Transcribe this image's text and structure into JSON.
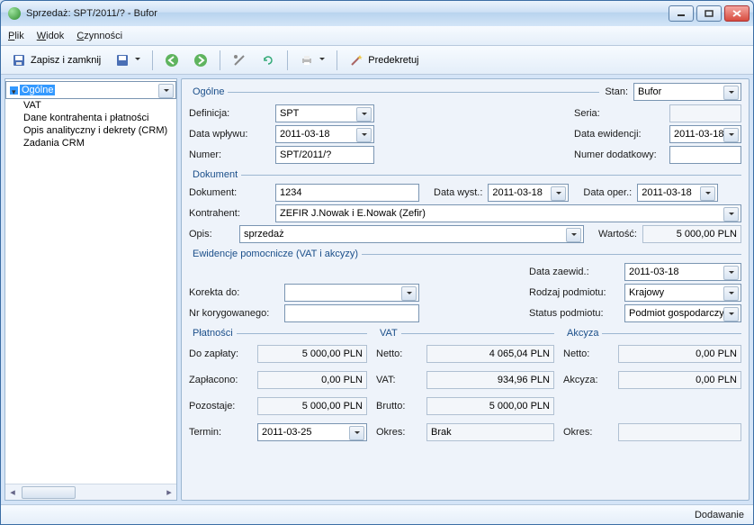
{
  "titlebar": {
    "title": "Sprzedaż: SPT/2011/? - Bufor"
  },
  "menu": {
    "plik": "Plik",
    "widok": "Widok",
    "czynnosci": "Czynności"
  },
  "toolbar": {
    "save_close": "Zapisz i zamknij",
    "predekretuj": "Predekretuj"
  },
  "sidebar": {
    "items": [
      "Ogólne",
      "VAT",
      "Dane kontrahenta i płatności",
      "Opis analityczny i dekrety (CRM)",
      "Zadania CRM"
    ]
  },
  "ogolne": {
    "legend": "Ogólne",
    "stan_label": "Stan:",
    "stan_value": "Bufor",
    "definicja_label": "Definicja:",
    "definicja_value": "SPT",
    "seria_label": "Seria:",
    "seria_value": "",
    "data_wplywu_label": "Data wpływu:",
    "data_wplywu_value": "2011-03-18",
    "data_ewid_label": "Data ewidencji:",
    "data_ewid_value": "2011-03-18",
    "numer_label": "Numer:",
    "numer_value": "SPT/2011/?",
    "numer_dod_label": "Numer dodatkowy:",
    "numer_dod_value": ""
  },
  "dokument": {
    "legend": "Dokument",
    "dokument_label": "Dokument:",
    "dokument_value": "1234",
    "data_wyst_label": "Data wyst.:",
    "data_wyst_value": "2011-03-18",
    "data_oper_label": "Data oper.:",
    "data_oper_value": "2011-03-18",
    "kontrahent_label": "Kontrahent:",
    "kontrahent_value": "ZEFIR J.Nowak i E.Nowak (Zefir)",
    "opis_label": "Opis:",
    "opis_value": "sprzedaż",
    "wartosc_label": "Wartość:",
    "wartosc_value": "5 000,00 PLN"
  },
  "ewid": {
    "legend": "Ewidencje pomocnicze (VAT i akcyzy)",
    "data_zaewid_label": "Data zaewid.:",
    "data_zaewid_value": "2011-03-18",
    "korekta_label": "Korekta do:",
    "korekta_value": "",
    "rodzaj_label": "Rodzaj podmiotu:",
    "rodzaj_value": "Krajowy",
    "nrkor_label": "Nr korygowanego:",
    "nrkor_value": "",
    "status_label": "Status podmiotu:",
    "status_value": "Podmiot gospodarczy"
  },
  "platnosci": {
    "legend": "Płatności",
    "do_zaplaty_label": "Do zapłaty:",
    "do_zaplaty_value": "5 000,00 PLN",
    "zaplacono_label": "Zapłacono:",
    "zaplacono_value": "0,00 PLN",
    "pozostaje_label": "Pozostaje:",
    "pozostaje_value": "5 000,00 PLN",
    "termin_label": "Termin:",
    "termin_value": "2011-03-25"
  },
  "vat": {
    "legend": "VAT",
    "netto_label": "Netto:",
    "netto_value": "4 065,04 PLN",
    "vat_label": "VAT:",
    "vat_value": "934,96 PLN",
    "brutto_label": "Brutto:",
    "brutto_value": "5 000,00 PLN",
    "okres_label": "Okres:",
    "okres_value": "Brak"
  },
  "akcyza": {
    "legend": "Akcyza",
    "netto_label": "Netto:",
    "netto_value": "0,00 PLN",
    "akcyza_label": "Akcyza:",
    "akcyza_value": "0,00 PLN",
    "okres_label": "Okres:",
    "okres_value": ""
  },
  "status": {
    "text": "Dodawanie"
  }
}
